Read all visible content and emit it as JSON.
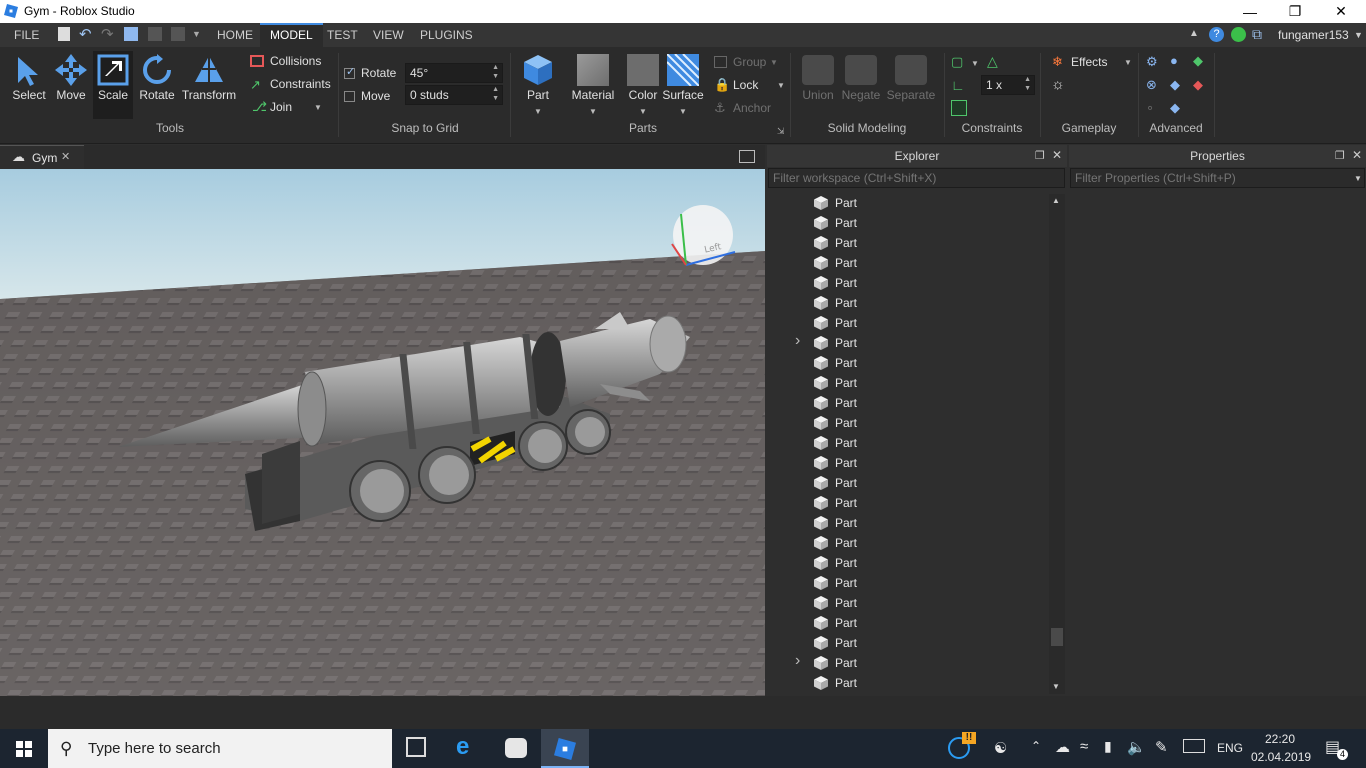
{
  "window": {
    "title": "Gym - Roblox Studio",
    "minimize_icon": "minimize-icon",
    "maximize_icon": "restore-icon",
    "close_icon": "close-icon"
  },
  "menu": {
    "tabs": [
      {
        "label": "FILE"
      },
      {
        "label": "HOME"
      },
      {
        "label": "MODEL"
      },
      {
        "label": "TEST"
      },
      {
        "label": "VIEW"
      },
      {
        "label": "PLUGINS"
      }
    ],
    "active_tab": "MODEL",
    "user": "fungamer153"
  },
  "ribbon": {
    "tools": {
      "group": "Tools",
      "select": "Select",
      "move": "Move",
      "scale": "Scale",
      "rotate": "Rotate",
      "transform": "Transform",
      "collisions": "Collisions",
      "constraints": "Constraints",
      "join": "Join"
    },
    "snap": {
      "group": "Snap to Grid",
      "rotate_label": "Rotate",
      "rotate_value": "45°",
      "move_label": "Move",
      "move_value": "0 studs"
    },
    "parts": {
      "group": "Parts",
      "part": "Part",
      "material": "Material",
      "color": "Color",
      "surface": "Surface",
      "group_btn": "Group",
      "lock": "Lock",
      "anchor": "Anchor"
    },
    "solid": {
      "group": "Solid Modeling",
      "union": "Union",
      "negate": "Negate",
      "separate": "Separate"
    },
    "constraints": {
      "group": "Constraints",
      "scale_value": "1 x"
    },
    "gameplay": {
      "group": "Gameplay",
      "effects": "Effects"
    },
    "advanced": {
      "group": "Advanced"
    }
  },
  "doc_tab": {
    "label": "Gym"
  },
  "viewcube": {
    "face_label": "Left"
  },
  "explorer": {
    "title": "Explorer",
    "filter_placeholder": "Filter workspace (Ctrl+Shift+X)",
    "items": [
      {
        "label": "Part",
        "expandable": false
      },
      {
        "label": "Part",
        "expandable": false
      },
      {
        "label": "Part",
        "expandable": false
      },
      {
        "label": "Part",
        "expandable": false
      },
      {
        "label": "Part",
        "expandable": false
      },
      {
        "label": "Part",
        "expandable": false
      },
      {
        "label": "Part",
        "expandable": false
      },
      {
        "label": "Part",
        "expandable": true
      },
      {
        "label": "Part",
        "expandable": false
      },
      {
        "label": "Part",
        "expandable": false
      },
      {
        "label": "Part",
        "expandable": false
      },
      {
        "label": "Part",
        "expandable": false
      },
      {
        "label": "Part",
        "expandable": false
      },
      {
        "label": "Part",
        "expandable": false
      },
      {
        "label": "Part",
        "expandable": false
      },
      {
        "label": "Part",
        "expandable": false
      },
      {
        "label": "Part",
        "expandable": false
      },
      {
        "label": "Part",
        "expandable": false
      },
      {
        "label": "Part",
        "expandable": false
      },
      {
        "label": "Part",
        "expandable": false
      },
      {
        "label": "Part",
        "expandable": false
      },
      {
        "label": "Part",
        "expandable": false
      },
      {
        "label": "Part",
        "expandable": false
      },
      {
        "label": "Part",
        "expandable": true
      },
      {
        "label": "Part",
        "expandable": false
      }
    ]
  },
  "properties": {
    "title": "Properties",
    "filter_placeholder": "Filter Properties (Ctrl+Shift+P)"
  },
  "taskbar": {
    "search_placeholder": "Type here to search",
    "language": "ENG",
    "time": "22:20",
    "date": "02.04.2019",
    "notification_count": "4"
  },
  "colors": {
    "accent": "#3f8ae0",
    "panel": "#2e2e2e",
    "ribbon": "#2b2b2b"
  }
}
